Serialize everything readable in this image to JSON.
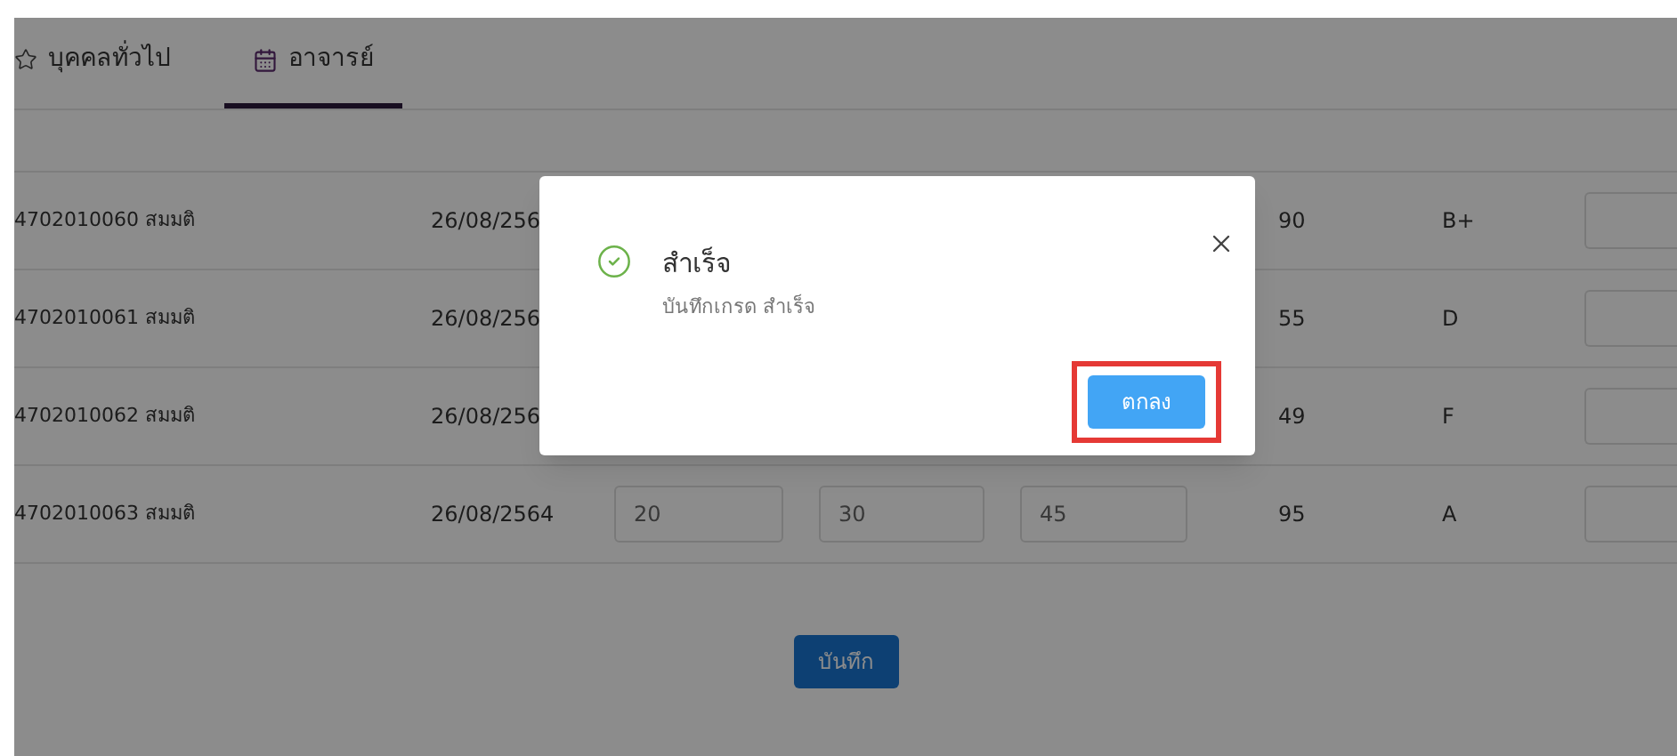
{
  "tabs": [
    {
      "label": "บุคคลทั่วไป",
      "kind": "star",
      "selected": false
    },
    {
      "label": "อาจารย์",
      "kind": "calendar",
      "selected": true
    }
  ],
  "rows": [
    {
      "student": "4702010060 สมมติ",
      "date": "26/08/256",
      "scores": [],
      "total": "90",
      "grade": "B+"
    },
    {
      "student": "4702010061 สมมติ",
      "date": "26/08/256",
      "scores": [],
      "total": "55",
      "grade": "D"
    },
    {
      "student": "4702010062 สมมติ",
      "date": "26/08/256",
      "scores": [],
      "total": "49",
      "grade": "F"
    },
    {
      "student": "4702010063 สมมติ",
      "date": "26/08/2564",
      "scores": [
        "20",
        "30",
        "45"
      ],
      "total": "95",
      "grade": "A"
    }
  ],
  "save_button": "บันทึก",
  "dialog": {
    "title": "สำเร็จ",
    "message": "บันทึกเกรด สำเร็จ",
    "ok_button": "ตกลง",
    "highlighted": true
  }
}
